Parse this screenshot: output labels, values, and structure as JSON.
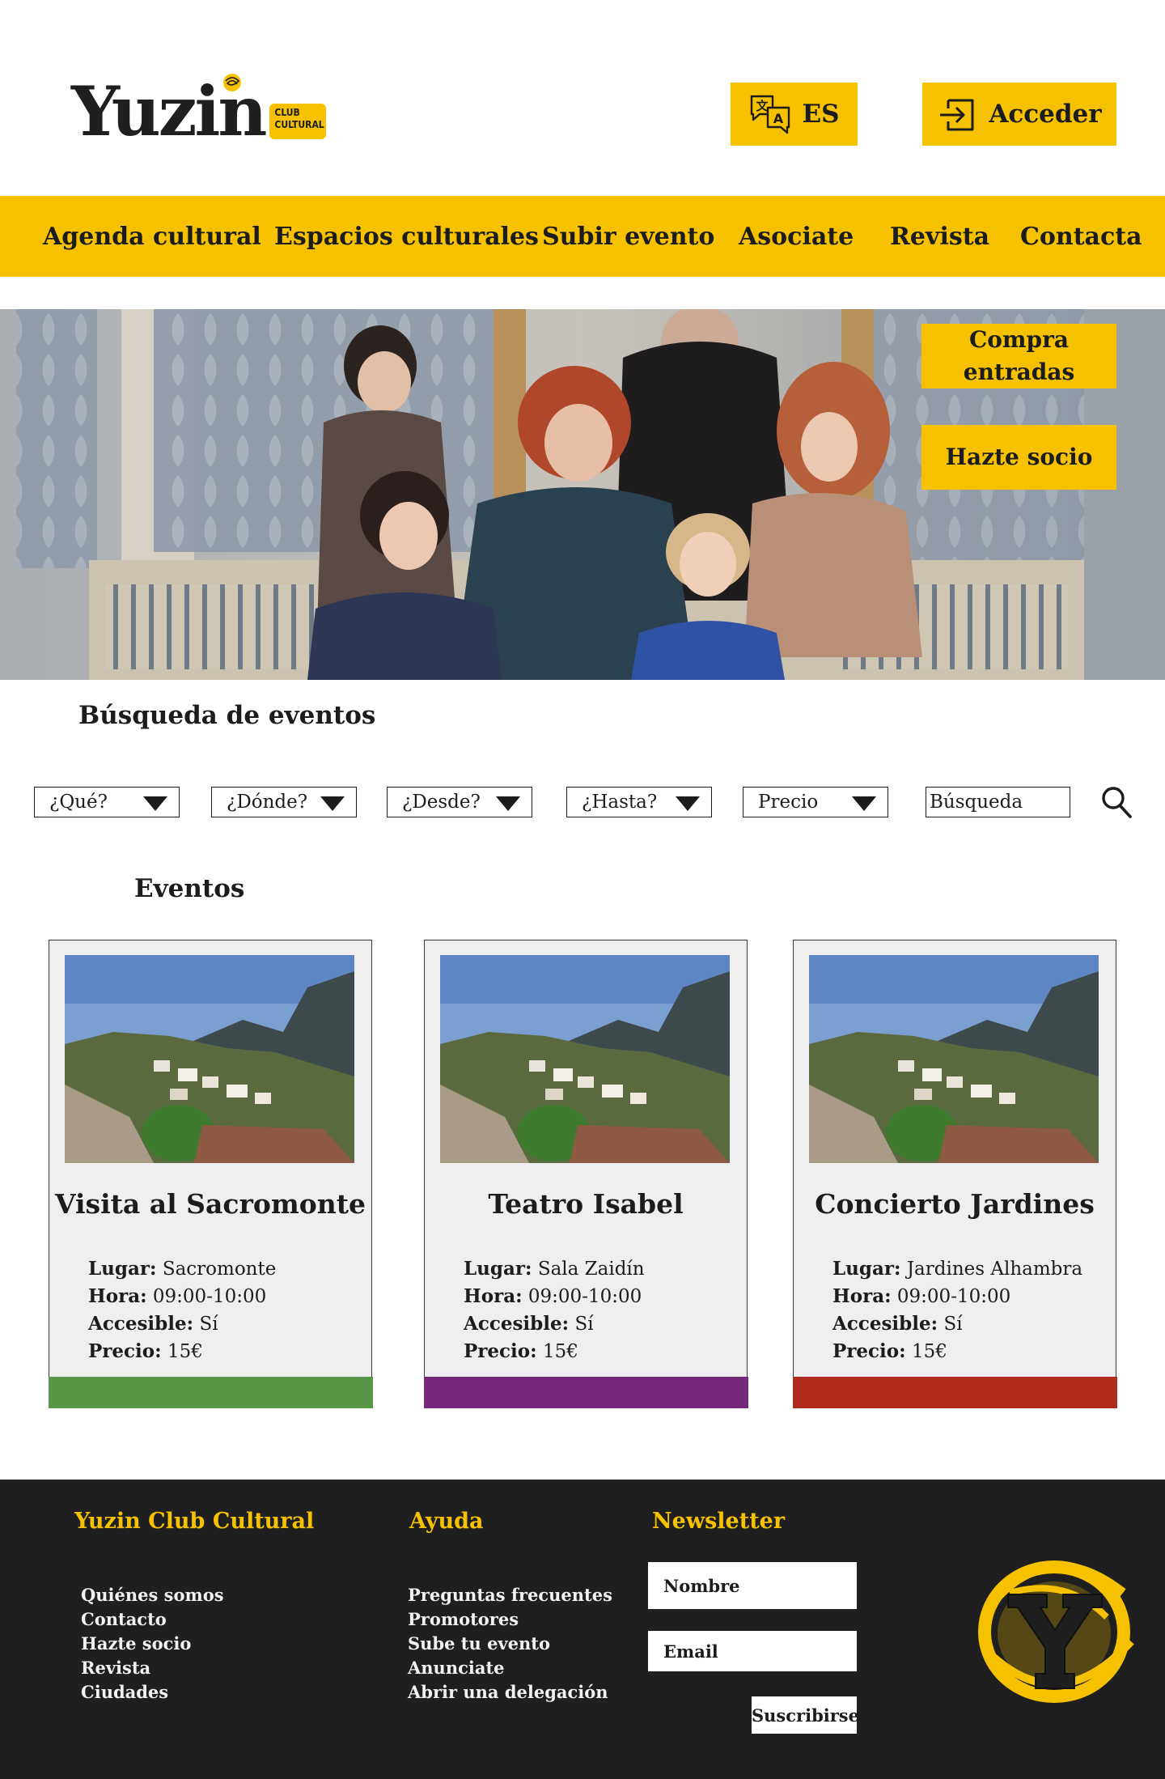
{
  "colors": {
    "accent": "#f6c200",
    "text": "#1c1c1c",
    "footer_bg": "#1f1f1f",
    "card_bg": "#efefef"
  },
  "header": {
    "logo_text": "Yuzin",
    "logo_tag_line1": "CLUB",
    "logo_tag_line2": "CULTURAL",
    "language_label": "ES",
    "language_icon": "translate-icon",
    "login_label": "Acceder",
    "login_icon": "login-icon"
  },
  "nav": {
    "items": [
      {
        "label": "Agenda cultural"
      },
      {
        "label": "Espacios culturales"
      },
      {
        "label": "Subir evento"
      },
      {
        "label": "Asociate"
      },
      {
        "label": "Revista"
      },
      {
        "label": "Contacta"
      }
    ]
  },
  "hero": {
    "buy_tickets_label": "Compra entradas",
    "become_member_label": "Hazte socio"
  },
  "search": {
    "title": "Búsqueda de eventos",
    "filters": [
      {
        "label": "¿Qué?"
      },
      {
        "label": "¿Dónde?"
      },
      {
        "label": "¿Desde?"
      },
      {
        "label": "¿Hasta?"
      },
      {
        "label": "Precio"
      }
    ],
    "input_placeholder": "Búsqueda",
    "search_icon": "search-icon"
  },
  "events": {
    "title": "Eventos",
    "labels": {
      "place": "Lugar:",
      "time": "Hora:",
      "accessible": "Accesible:",
      "price": "Precio:"
    },
    "cards": [
      {
        "title": "Visita al Sacromonte",
        "place": "Sacromonte",
        "time": "09:00-10:00",
        "accessible": "Sí",
        "price": "15€",
        "bar_color": "#5a9647"
      },
      {
        "title": "Teatro Isabel",
        "place": "Sala Zaidín",
        "time": "09:00-10:00",
        "accessible": "Sí",
        "price": "15€",
        "bar_color": "#76287a"
      },
      {
        "title": "Concierto Jardines",
        "place": "Jardines Alhambra",
        "time": "09:00-10:00",
        "accessible": "Sí",
        "price": "15€",
        "bar_color": "#ad2a1c"
      }
    ]
  },
  "footer": {
    "col1": {
      "title": "Yuzin Club Cultural",
      "links": [
        "Quiénes somos",
        "Contacto",
        "Hazte socio",
        "Revista",
        "Ciudades"
      ]
    },
    "col2": {
      "title": "Ayuda",
      "links": [
        "Preguntas frecuentes",
        "Promotores",
        "Sube tu evento",
        "Anunciate",
        "Abrir una delegación"
      ]
    },
    "newsletter": {
      "title": "Newsletter",
      "name_placeholder": "Nombre",
      "email_placeholder": "Email",
      "submit_label": "Suscribirse"
    },
    "logo_icon": "yuzin-y-logo-icon"
  }
}
